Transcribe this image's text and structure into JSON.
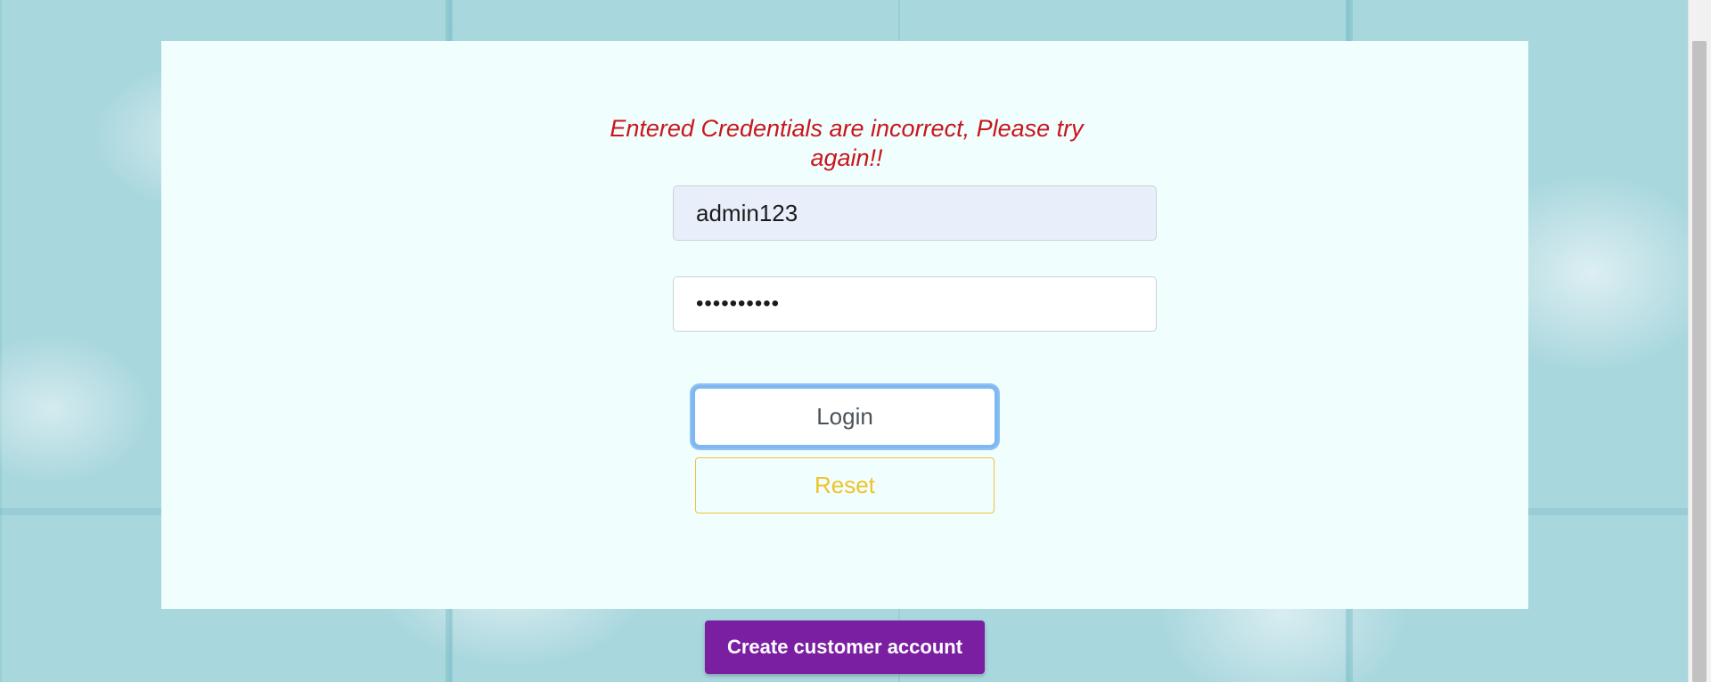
{
  "login": {
    "error_message": "Entered Credentials are incorrect, Please try again!!",
    "username_value": "admin123",
    "password_value": "••••••••••",
    "login_label": "Login",
    "reset_label": "Reset"
  },
  "footer": {
    "create_account_label": "Create customer account"
  },
  "colors": {
    "error": "#c8161d",
    "reset": "#f0c12a",
    "create_account": "#7b1fa2",
    "panel": "#f0fffe",
    "login_focus": "#8ec2f5"
  }
}
